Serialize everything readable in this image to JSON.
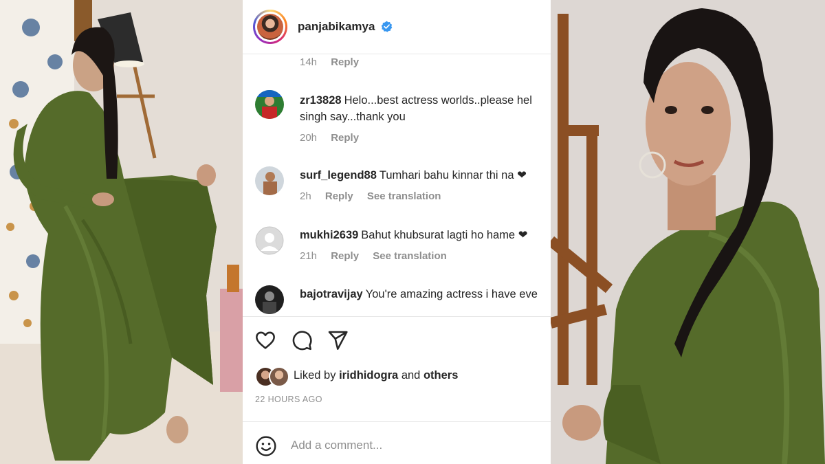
{
  "post": {
    "username": "panjabikamya",
    "verified_icon": "verified-badge-icon",
    "timestamp": "22 HOURS AGO"
  },
  "first_meta": {
    "time": "14h",
    "reply": "Reply"
  },
  "comments": [
    {
      "handle": "zr13828",
      "text": "Helo...best actress worlds..please hel singh say...thank you",
      "time": "20h",
      "reply": "Reply",
      "translate": ""
    },
    {
      "handle": "surf_legend88",
      "text": "Tumhari bahu kinnar thi na ❤",
      "time": "2h",
      "reply": "Reply",
      "translate": "See translation"
    },
    {
      "handle": "mukhi2639",
      "text": "Bahut khubsurat lagti ho hame ❤",
      "time": "21h",
      "reply": "Reply",
      "translate": "See translation"
    },
    {
      "handle": "bajotravijay",
      "text": "You're amazing actress i have eve",
      "time": "",
      "reply": "",
      "translate": ""
    }
  ],
  "likes": {
    "prefix": "Liked by",
    "user": "iridhidogra",
    "conj": "and",
    "others": "others"
  },
  "add_comment": {
    "placeholder": "Add a comment..."
  },
  "colors": {
    "saree_green": "#556b2a",
    "verified_blue": "#3897f0",
    "text_primary": "#262626",
    "text_secondary": "#8e8e8e"
  }
}
